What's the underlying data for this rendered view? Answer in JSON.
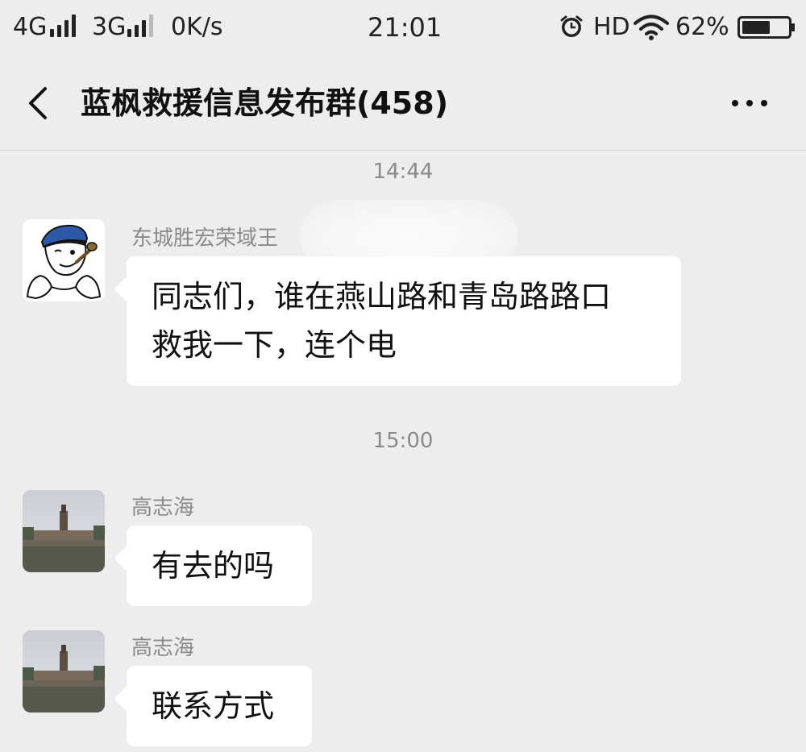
{
  "status_bar": {
    "network_1": "4G",
    "network_2": "3G",
    "speed": "0K/s",
    "time": "21:01",
    "hd": "HD",
    "battery": "62%",
    "battery_level": 0.62,
    "icons": [
      "signal-icon",
      "alarm-icon",
      "wifi-icon",
      "battery-icon"
    ]
  },
  "header": {
    "title": "蓝枫救援信息发布群(458)",
    "back_icon": "chevron-left-icon",
    "more_icon": "more-icon"
  },
  "messages": [
    {
      "timestamp": "14:44",
      "sender": "东城胜宏荣域王",
      "avatar": "cartoon-sailor-avatar",
      "lines": [
        "同志们，谁在燕山路和青岛路路口",
        "救我一下，连个电"
      ]
    },
    {
      "timestamp": "15:00",
      "sender": "高志海",
      "avatar": "landscape-building-avatar",
      "lines": [
        "有去的吗"
      ]
    },
    {
      "sender": "高志海",
      "avatar": "landscape-building-avatar",
      "lines": [
        "联系方式"
      ]
    }
  ],
  "colors": {
    "background": "#ededed",
    "bubble": "#ffffff",
    "meta_text": "#8a8a8a"
  }
}
